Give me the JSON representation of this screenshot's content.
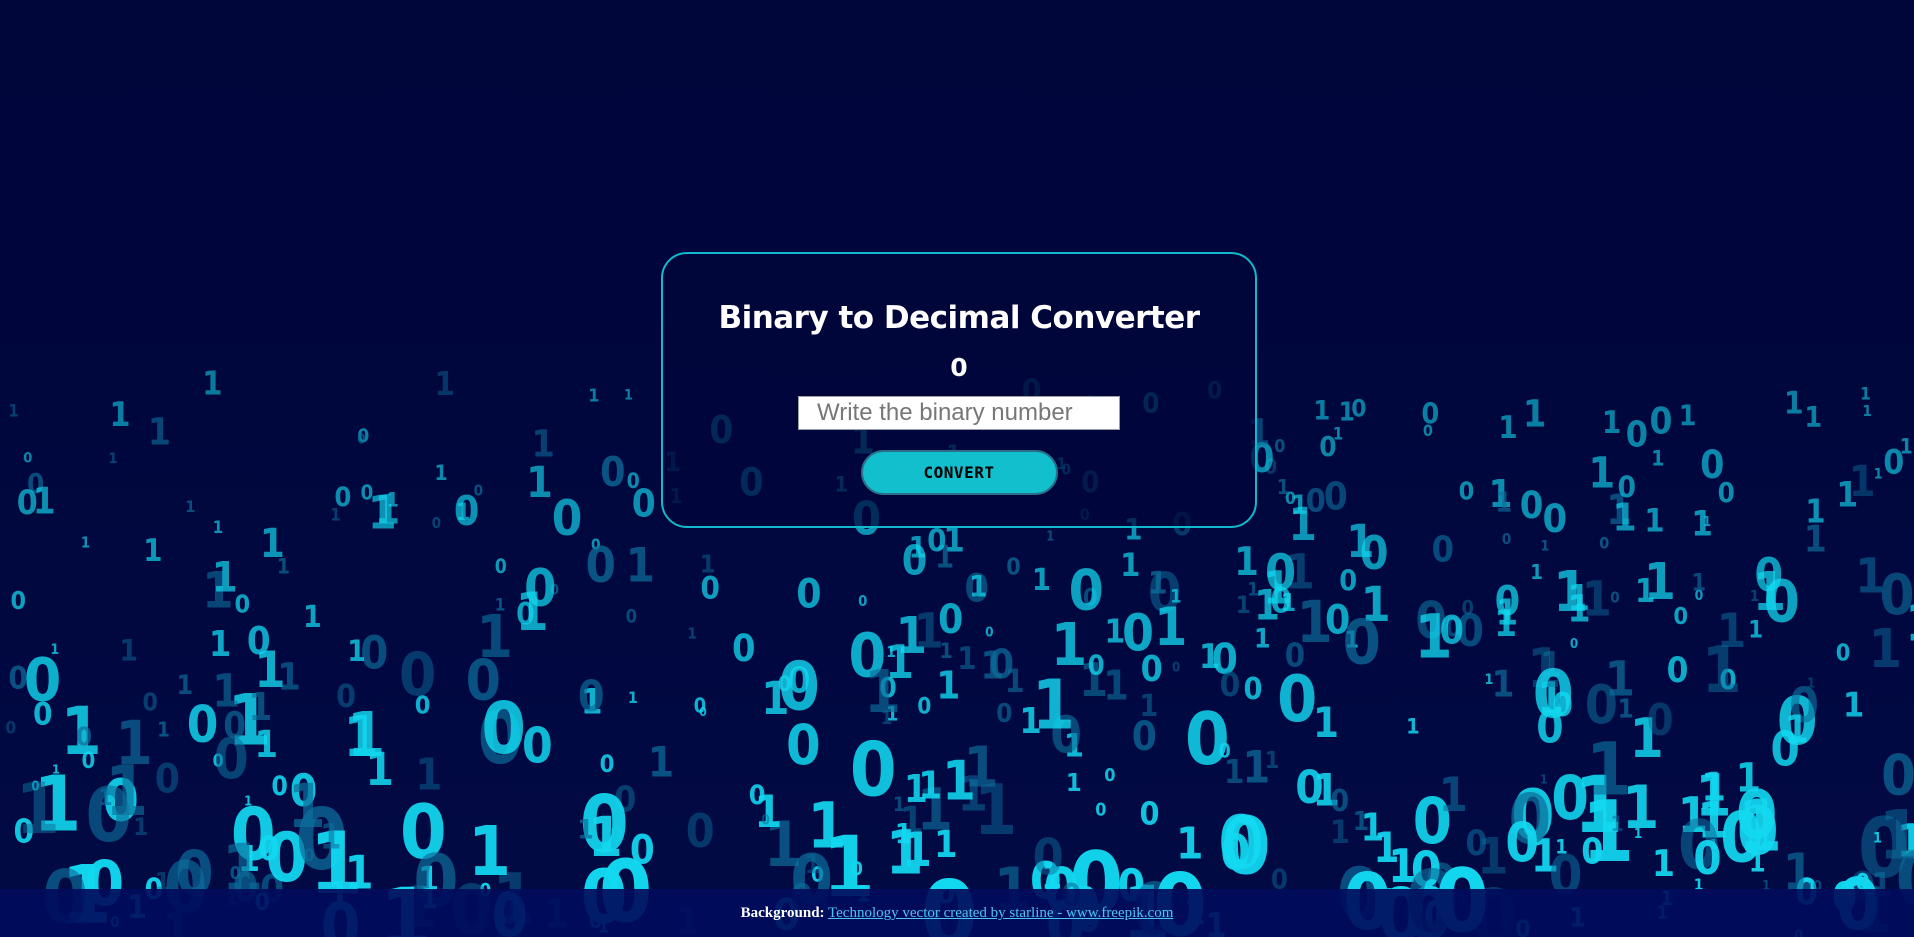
{
  "converter": {
    "title": "Binary to Decimal Converter",
    "result": "0",
    "input_placeholder": "Write the binary number",
    "input_value": "",
    "button_label": "CONVERT"
  },
  "footer": {
    "label": "Background:",
    "link_text": "Technology vector created by starline - www.freepik.com"
  },
  "colors": {
    "background": "#00063a",
    "accent": "#12bfcd",
    "digits_bright": "#12d8f0",
    "digits_dim": "#0d6f9c"
  }
}
